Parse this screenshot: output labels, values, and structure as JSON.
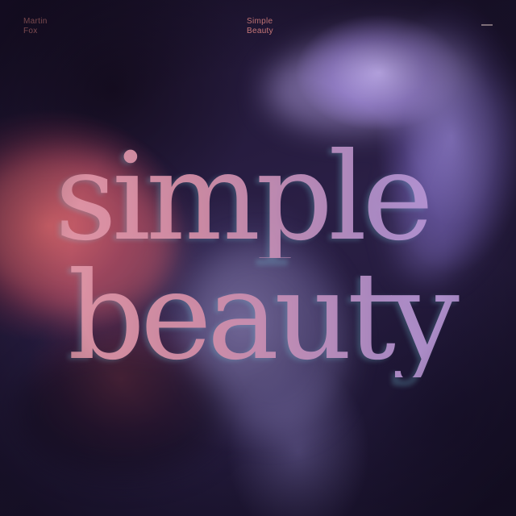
{
  "cover": {
    "artist": "Martin Fox",
    "artist_line1": "Martin",
    "artist_line2": "Fox",
    "album_line1": "Simple",
    "album_line2": "Beauty",
    "title_line1": "simple",
    "title_line2": "beauty",
    "menu_icon": "dash-menu-icon"
  },
  "colors": {
    "background": "#1a1226",
    "accent_text": "#e88a8a",
    "title_pink": "#e89aa6",
    "title_lavender": "#c2a5f0"
  }
}
